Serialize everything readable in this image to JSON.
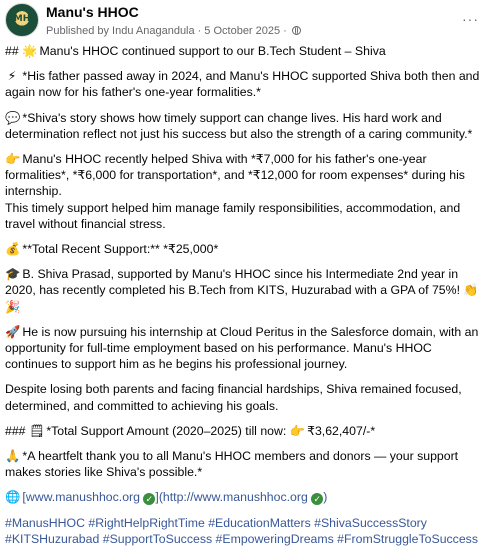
{
  "header": {
    "page_name": "Manu's HHOC",
    "avatar_initials": "MH",
    "published_by": "Published by Indu Anagandula",
    "separator": "·",
    "date": "5 October 2025",
    "menu_dots": "···"
  },
  "post": {
    "p1_icon": "🌟",
    "p1_prefix": "## ",
    "p1_text": " Manu's HHOC continued support to our B.Tech Student – Shiva",
    "p2_icon": "⚡",
    "p2_text": " *His father passed away in 2024, and Manu's HHOC supported Shiva both then and again now for his father's one-year formalities.*",
    "p3_icon": "💬",
    "p3_text": " *Shiva's story shows how timely support can change lives. His hard work and determination reflect not just his success but also the strength of a caring community.*",
    "p4_icon": "👉",
    "p4_text": " Manu's HHOC recently helped Shiva with *₹7,000 for his father's one-year formalities*, *₹6,000 for transportation*, and *₹12,000 for room expenses* during his internship.",
    "p4_text_2": "This timely support helped him manage family responsibilities, accommodation, and travel without financial stress.",
    "p5_icon": "💰",
    "p5_text": " **Total Recent Support:** *₹25,000*",
    "p6_icon": "🎓",
    "p6_text": " B. Shiva Prasad, supported by Manu's HHOC since his Intermediate 2nd year in 2020, has recently completed his B.Tech from KITS, Huzurabad with a GPA of 75%! ",
    "p6_emoji_end": "👏🎉",
    "p7_icon": "🚀",
    "p7_text": " He is now pursuing his internship at Cloud Peritus in the Salesforce domain, with an opportunity for full-time employment based on his performance. Manu's HHOC continues to support him as he begins his professional journey.",
    "p8_text": "Despite losing both parents and facing financial hardships, Shiva remained focused, determined, and committed to achieving his goals.",
    "p9_prefix": "### ",
    "p9_icon": "🗒",
    "p9_text": " *Total Support Amount (2020–2025) till now: ",
    "p9_icon2": "👉",
    "p9_amount": " ₹3,62,407/-*",
    "p10_icon": "🙏",
    "p10_text": " *A heartfelt thank you to all Manu's HHOC members and donors — your support makes stories like Shiva's possible.*",
    "link_icon": "🌐",
    "link_part1": " [www.manushhoc.org ",
    "link_part2": "](http://www.manushhoc.org ",
    "link_part3": ")",
    "check_glyph": "✓",
    "hashtags": "#ManusHHOC #RightHelpRightTime #EducationMatters #ShivaSuccessStory #KITSHuzurabad #SupportToSuccess #EmpoweringDreams #FromStruggleToSuccess"
  },
  "colors": {
    "link": "#385898",
    "meta": "#65676b",
    "text": "#050505",
    "check_badge": "#3a8e3e"
  },
  "icons": {
    "avatar": "page-avatar",
    "globe": "public-audience-icon",
    "menu": "more-options-icon"
  }
}
